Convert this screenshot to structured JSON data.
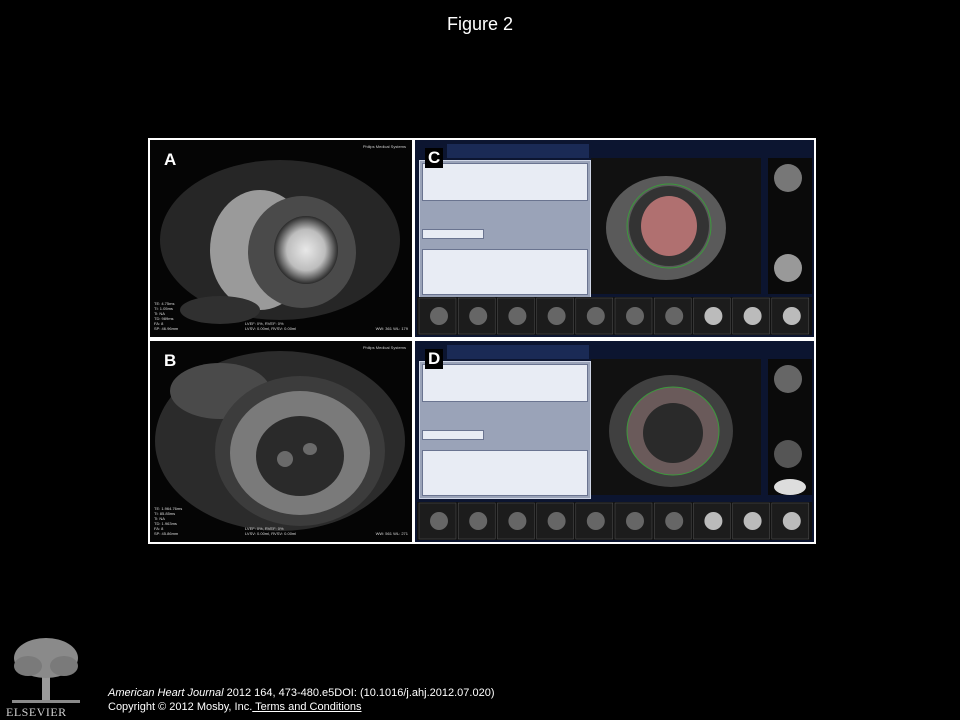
{
  "slide": {
    "title": "Figure 2"
  },
  "panels": [
    {
      "label": "A",
      "vendor": "Philips Medical Systems",
      "params": "TE: 4.75ms\nTI: 1.05ms\nTi: NA\nTD: 989ms\nFA: 8\nSP: 46.96mm",
      "lv": "LVEF: 0%, RVEF: 0%\nLVSV: 0.00ml, RVSV: 0.00ml",
      "wwwl": "WW: 361 WL: 179"
    },
    {
      "label": "B",
      "vendor": "Philips Medical Systems",
      "params": "TE: 1.964.76ms\nTI: 85.85ms\nTi: NA\nTD: 1.963ms\nFA: 8\nSP: 45.86mm",
      "lv": "LVEF: 0%, RVEF: 0%\nLVSV: 0.00ml, RVSV: 0.00ml",
      "wwwl": "WW: 561 WL: 271"
    },
    {
      "label": "C"
    },
    {
      "label": "D"
    }
  ],
  "citation": {
    "journal": "American Heart Journal",
    "details": " 2012 164, 473-480.e5DOI: (10.1016/j.ahj.2012.07.020)",
    "copyright": "Copyright © 2012 Mosby, Inc.",
    "link": " Terms and Conditions"
  },
  "logo": {
    "icon": "elsevier-tree-icon",
    "text": "ELSEVIER"
  }
}
